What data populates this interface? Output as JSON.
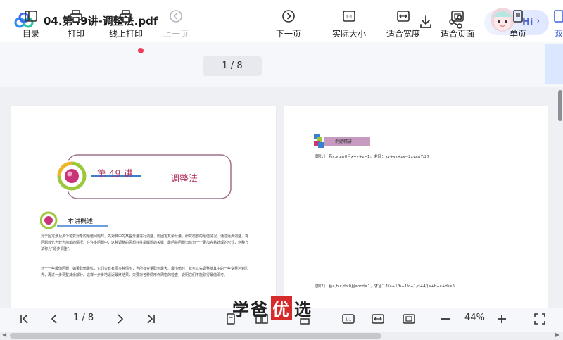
{
  "window": {
    "title": "04.第49讲-调整法.pdf",
    "hi_label": "Hi",
    "hi_chevron": "›"
  },
  "toolbar": {
    "items": [
      {
        "label": "目录",
        "icon": "toc-icon"
      },
      {
        "label": "打印",
        "icon": "printer-icon"
      },
      {
        "label": "线上打印",
        "icon": "online-print-icon"
      },
      {
        "label": "上一页",
        "icon": "prev-page-icon"
      },
      {
        "label": "下一页",
        "icon": "next-page-icon"
      },
      {
        "label": "实际大小",
        "icon": "actual-size-icon"
      },
      {
        "label": "适合宽度",
        "icon": "fit-width-icon"
      },
      {
        "label": "适合页面",
        "icon": "fit-page-icon"
      },
      {
        "label": "单页",
        "icon": "single-page-icon"
      },
      {
        "label": "双",
        "icon": "double-page-icon"
      }
    ],
    "page_indicator": "1 / 8"
  },
  "document": {
    "left_page": {
      "lesson_number": "第 49 讲",
      "lesson_name": "调整法",
      "section_title": "本讲概述",
      "paragraph_1": "对于固定涉及多个可变对象的最值问题时，先对其中的某些分量进行调整，即固定其余分量，研究局部的最值情况。通过逐步调整，将问题转化为较为简单的情况。在许多问题中，这种调整的思想往往是解题的关键，最后将问题归结为一个更加容易处理的形式，这种方法称为“逐步调整”。",
      "paragraph_2": "对于一些最值问题，如果取值最优，它们只有有限多种情形，当所有变量取到最大、最小值时，就可以先调整使其中的一些变量达到边界，再进一步调整其余部分。这样一步步地逼近最终结果，只要对各种情形作周密的检查，说明它们不能取得最值即可。"
    },
    "right_page": {
      "badge_text": "例题精讲",
      "example_1": "【例1】 若x,y,z≥0且x+y+z=1，求证：xy+yz+zx−2xyz≤7/27",
      "example_2": "【例2】 若a,b,c,d>0且abcd=1，求证：1/a+1/b+1/c+1/d+4/(a+b+c+d)≥5"
    }
  },
  "bottombar": {
    "page_indicator": "1 / 8",
    "zoom": "44%"
  },
  "watermark": {
    "part1": "学爸",
    "highlight": "优",
    "part2": "选"
  },
  "colors": {
    "accent": "#5366c9",
    "brand_red": "#d72b2b",
    "title_magenta": "#b1345c",
    "notification_dot": "#f03c5a"
  }
}
